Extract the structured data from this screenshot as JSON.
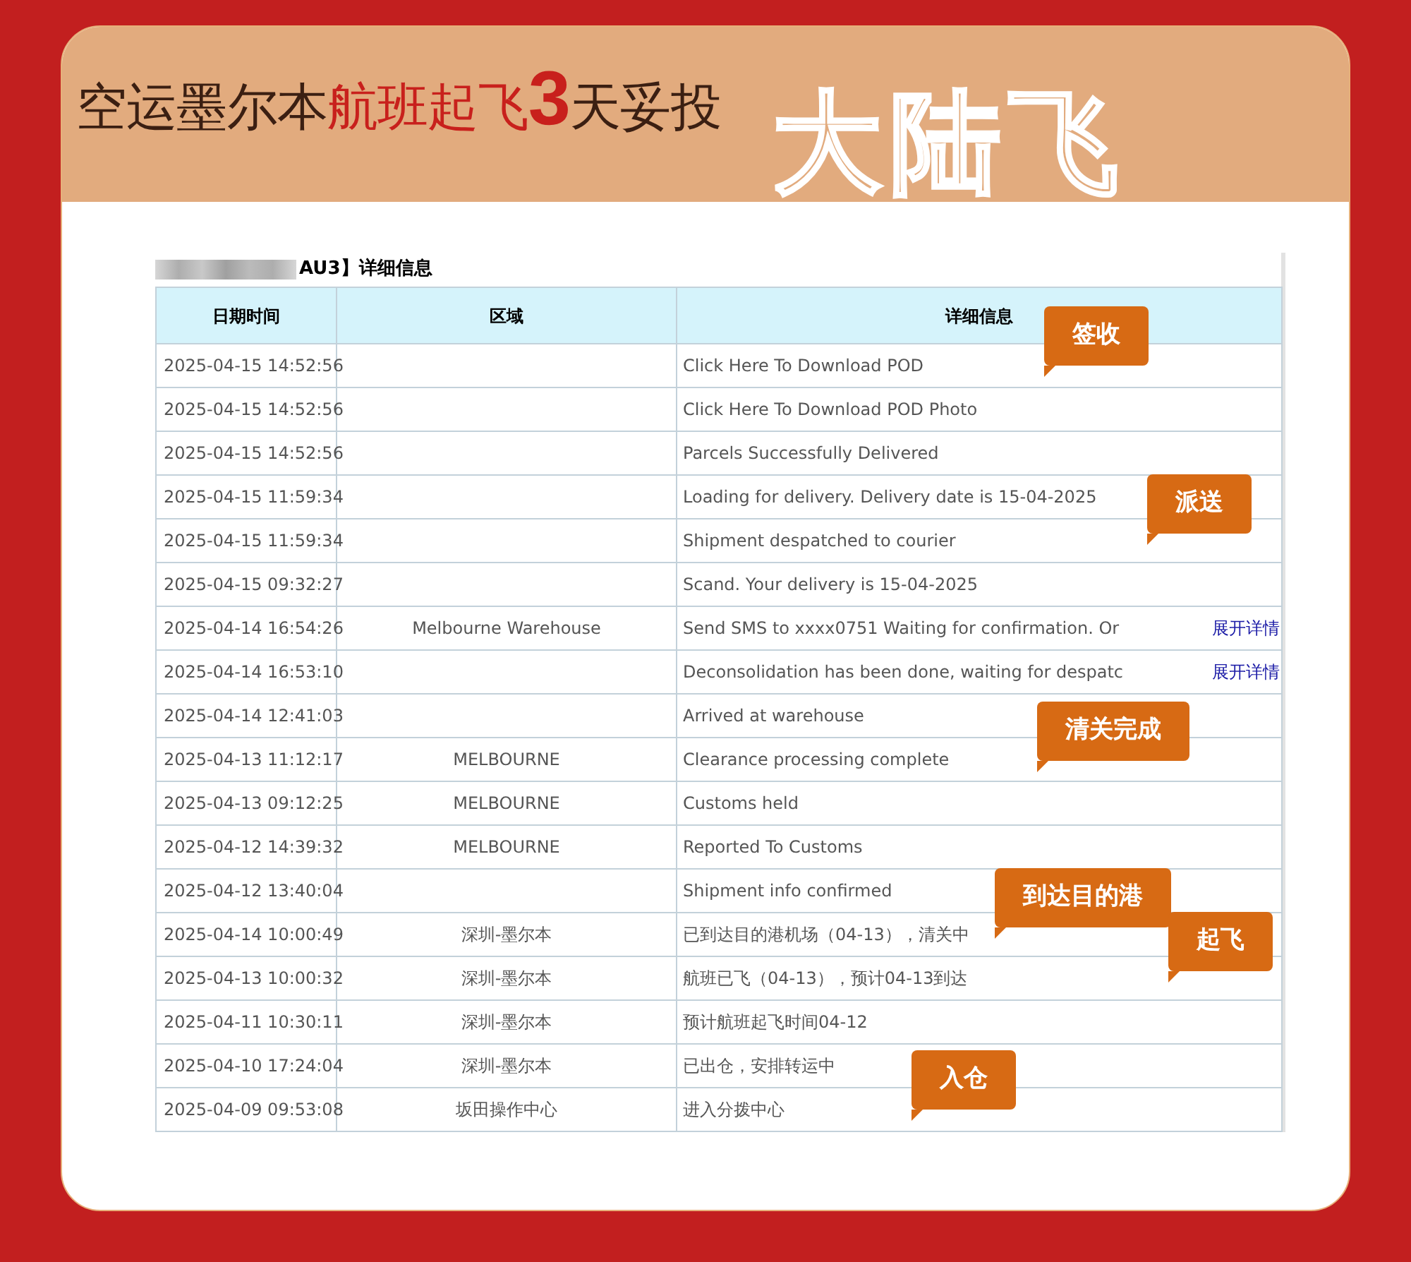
{
  "banner": {
    "title": [
      {
        "text": "空运墨尔本",
        "kind": "plain"
      },
      {
        "text": "航班起飞",
        "kind": "highlight"
      },
      {
        "text": "3",
        "kind": "number"
      },
      {
        "text": "天妥投",
        "kind": "plain"
      }
    ],
    "brand": "大陆飞"
  },
  "tracking": {
    "title": "AU3】详细信息",
    "columns": [
      "日期时间",
      "区域",
      "详细信息"
    ],
    "rows": [
      {
        "date": "2025-04-15 14:52:56",
        "region": "",
        "detail": "Click Here To Download POD"
      },
      {
        "date": "2025-04-15 14:52:56",
        "region": "",
        "detail": "Click Here To Download POD Photo"
      },
      {
        "date": "2025-04-15 14:52:56",
        "region": "",
        "detail": "Parcels Successfully Delivered"
      },
      {
        "date": "2025-04-15 11:59:34",
        "region": "",
        "detail": "Loading for delivery. Delivery date is 15-04-2025"
      },
      {
        "date": "2025-04-15 11:59:34",
        "region": "",
        "detail": "Shipment despatched to courier"
      },
      {
        "date": "2025-04-15 09:32:27",
        "region": "",
        "detail": "Scand. Your delivery is 15-04-2025"
      },
      {
        "date": "2025-04-14 16:54:26",
        "region": "Melbourne Warehouse",
        "detail": "Send SMS to xxxx0751 Waiting for confirmation. Or",
        "link": "展开详情"
      },
      {
        "date": "2025-04-14 16:53:10",
        "region": "",
        "detail": "Deconsolidation has been done, waiting for despatc",
        "link": "展开详情"
      },
      {
        "date": "2025-04-14 12:41:03",
        "region": "",
        "detail": "Arrived at warehouse"
      },
      {
        "date": "2025-04-13 11:12:17",
        "region": "MELBOURNE",
        "detail": "Clearance processing complete"
      },
      {
        "date": "2025-04-13 09:12:25",
        "region": "MELBOURNE",
        "detail": "Customs held"
      },
      {
        "date": "2025-04-12 14:39:32",
        "region": "MELBOURNE",
        "detail": "Reported To Customs"
      },
      {
        "date": "2025-04-12 13:40:04",
        "region": "",
        "detail": "Shipment info confirmed"
      },
      {
        "date": "2025-04-14 10:00:49",
        "region": "深圳-墨尔本",
        "detail": "已到达目的港机场（04-13），清关中"
      },
      {
        "date": "2025-04-13 10:00:32",
        "region": "深圳-墨尔本",
        "detail": "航班已飞（04-13），预计04-13到达"
      },
      {
        "date": "2025-04-11 10:30:11",
        "region": "深圳-墨尔本",
        "detail": "预计航班起飞时间04-12"
      },
      {
        "date": "2025-04-10 17:24:04",
        "region": "深圳-墨尔本",
        "detail": "已出仓，安排转运中"
      },
      {
        "date": "2025-04-09 09:53:08",
        "region": "坂田操作中心",
        "detail": "进入分拨中心"
      }
    ],
    "callouts": [
      "签收",
      "派送",
      "清关完成",
      "到达目的港",
      "起飞",
      "入仓"
    ]
  }
}
